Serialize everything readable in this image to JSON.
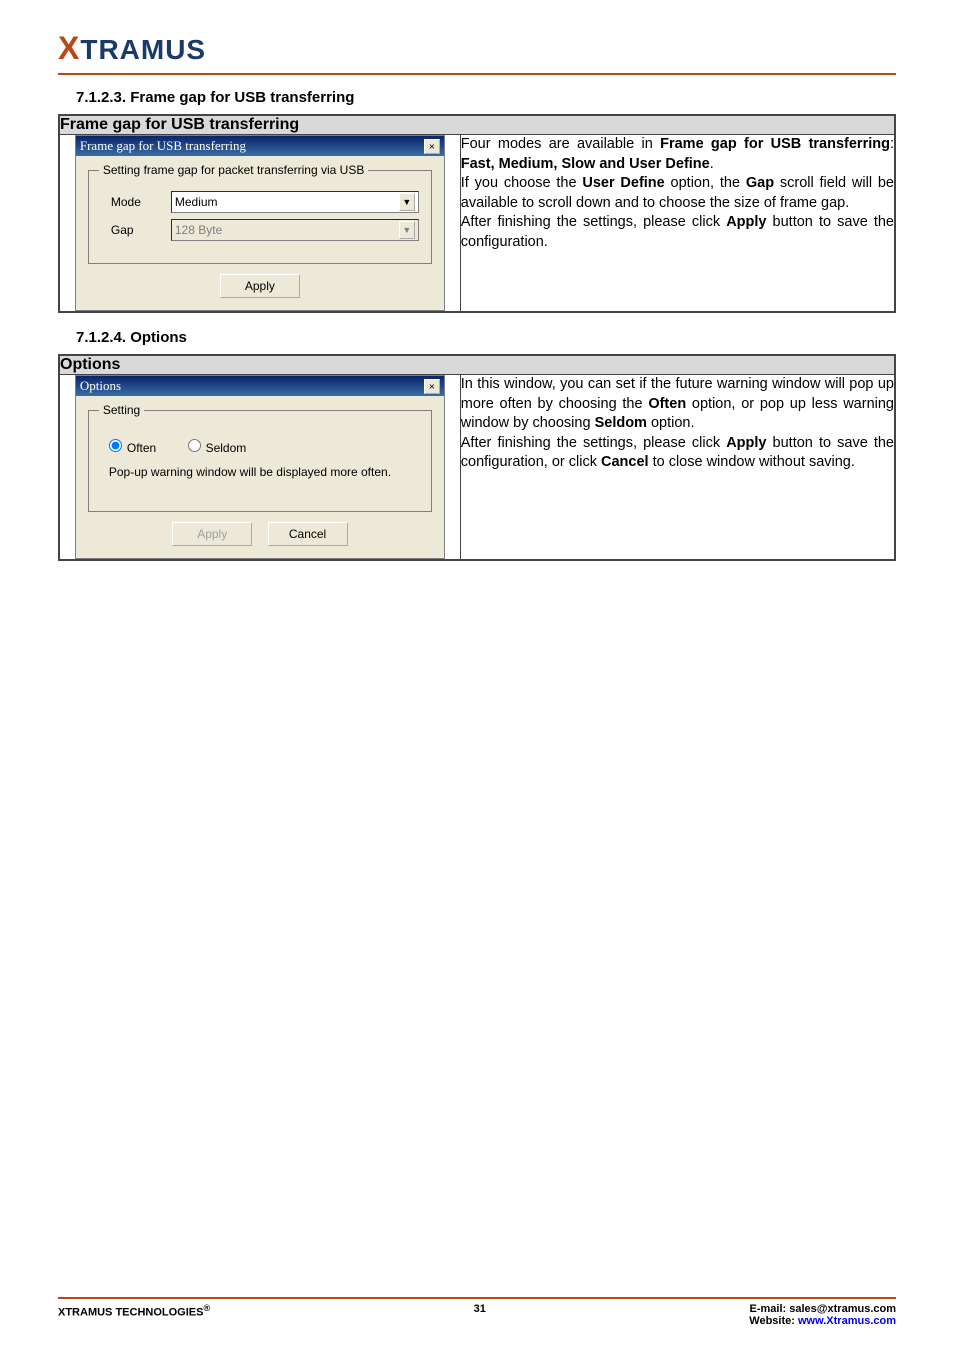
{
  "logo": {
    "x": "X",
    "rest": "TRAMUS"
  },
  "section1": {
    "heading": "7.1.2.3. Frame gap for USB transferring",
    "table_title": "Frame gap for USB transferring",
    "win_title": "Frame gap for USB transferring",
    "fieldset_legend": "Setting frame gap for packet transferring via USB",
    "mode_label": "Mode",
    "mode_value": "Medium",
    "gap_label": "Gap",
    "gap_value": "128 Byte",
    "apply_btn": "Apply",
    "desc_1a": "Four modes are available in ",
    "desc_1b": "Frame gap for USB transferring",
    "desc_1c": ": ",
    "desc_1d": "Fast, Medium, Slow and User Define",
    "desc_1e": ".",
    "desc_2a": "If you choose the ",
    "desc_2b": "User Define",
    "desc_2c": " option, the ",
    "desc_2d": "Gap",
    "desc_2e": " scroll field will be available to scroll down and to choose the size of frame gap.",
    "desc_3a": "After finishing the settings, please click ",
    "desc_3b": "Apply",
    "desc_3c": " button to save the configuration."
  },
  "section2": {
    "heading": "7.1.2.4. Options",
    "table_title": "Options",
    "win_title": "Options",
    "fieldset_legend": "Setting",
    "radio_often": "Often",
    "radio_seldom": "Seldom",
    "popup_text": "Pop-up warning window will be displayed more often.",
    "apply_btn": "Apply",
    "cancel_btn": "Cancel",
    "desc_1a": "In this window, you can set if the future warning window will pop up more often by choosing the ",
    "desc_1b": "Often",
    "desc_1c": " option, or pop up less warning window by choosing ",
    "desc_1d": "Seldom",
    "desc_1e": " option.",
    "desc_2a": "After finishing the settings, please click ",
    "desc_2b": "Apply",
    "desc_2c": " button to save the configuration, or click ",
    "desc_2d": "Cancel",
    "desc_2e": " to close window without saving."
  },
  "footer": {
    "left": "XTRAMUS TECHNOLOGIES",
    "reg": "®",
    "page": "31",
    "email_label": "E-mail: ",
    "email": "sales@xtramus.com",
    "site_label": "Website:  ",
    "site": "www.Xtramus.com"
  }
}
